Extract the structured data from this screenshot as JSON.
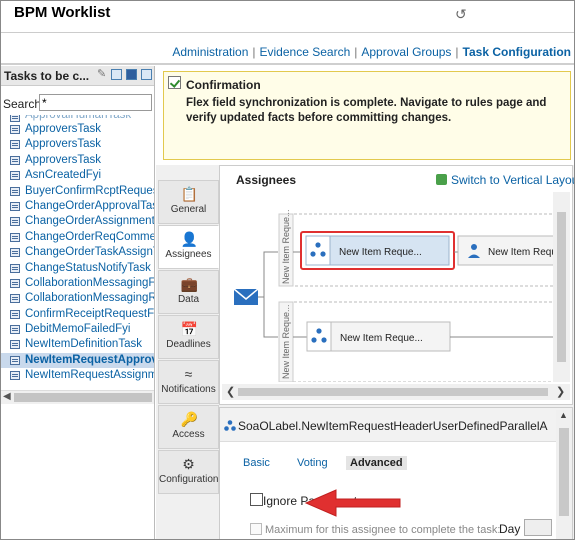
{
  "header": {
    "app_title": "BPM Worklist",
    "refresh_icon": "refresh-icon"
  },
  "topnav": {
    "links": [
      "Administration",
      "Evidence Search",
      "Approval Groups",
      "Task Configuration"
    ],
    "separator": "|"
  },
  "left_panel": {
    "title": "Tasks to be c...",
    "search_label": "Search",
    "search_value": "*",
    "tasks": [
      "ApprovalHumanTask",
      "ApproversTask",
      "ApproversTask",
      "ApproversTask",
      "AsnCreatedFyi",
      "BuyerConfirmRcptRequest",
      "ChangeOrderApprovalTask",
      "ChangeOrderAssignment",
      "ChangeOrderReqComment",
      "ChangeOrderTaskAssignTa",
      "ChangeStatusNotifyTask",
      "CollaborationMessagingFY",
      "CollaborationMessagingRe",
      "ConfirmReceiptRequestFo",
      "DebitMemoFailedFyi",
      "NewItemDefinitionTask",
      "NewItemRequestApprov",
      "NewItemRequestAssignme"
    ],
    "selected_index": 16
  },
  "confirmation": {
    "title": "Confirmation",
    "message": "Flex field synchronization is complete. Navigate to rules page and verify updated facts before committing changes."
  },
  "vertical_tabs": [
    {
      "label": "General",
      "icon": "clipboard-icon"
    },
    {
      "label": "Assignees",
      "icon": "user-icon"
    },
    {
      "label": "Data",
      "icon": "briefcase-icon"
    },
    {
      "label": "Deadlines",
      "icon": "calendar-icon"
    },
    {
      "label": "Notifications",
      "icon": "rss-icon"
    },
    {
      "label": "Access",
      "icon": "key-icon"
    },
    {
      "label": "Configuration",
      "icon": "gear-icon"
    }
  ],
  "active_tab": "Assignees",
  "assignees": {
    "title": "Assignees",
    "switch_link": "Switch to Vertical Layout",
    "stage_label_top": "New Item Reque...",
    "stage_label_bottom": "New Item Reque...",
    "node_selected": "New Item Reque...",
    "node_next": "New Item Reque",
    "node_bottom": "New Item Reque..."
  },
  "detail": {
    "title": "SoaOLabel.NewItemRequestHeaderUserDefinedParallelA",
    "tabs": [
      "Basic",
      "Voting",
      "Advanced"
    ],
    "active_tab": "Advanced",
    "ignore_participant": "Ignore Participant",
    "max_label": "Maximum for this assignee to complete the task:",
    "day_label": "Day"
  },
  "colors": {
    "link": "#0b62a4",
    "highlight": "#e03030",
    "confirm_bg": "#fffde8"
  }
}
